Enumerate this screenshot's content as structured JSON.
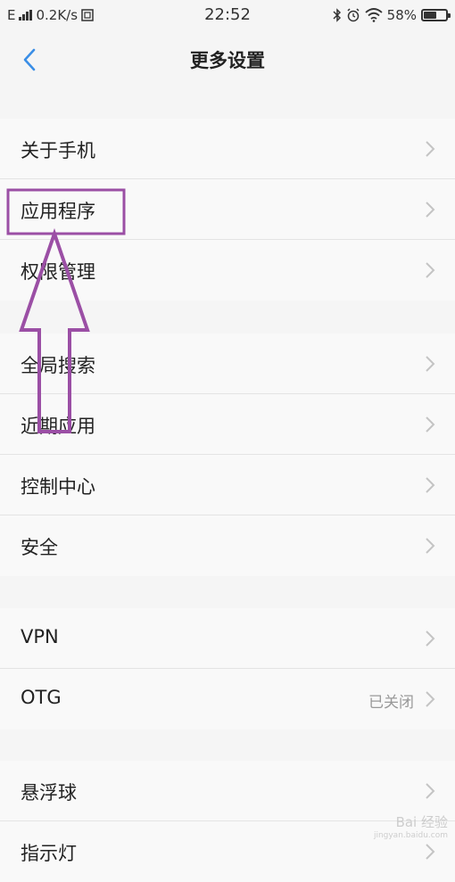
{
  "status_bar": {
    "network_type": "E",
    "speed": "0.2K/s",
    "time": "22:52",
    "battery_percent": "58%",
    "battery_level": 0.58,
    "icons": [
      "signal-icon",
      "sim-icon",
      "bluetooth-icon",
      "alarm-icon",
      "wifi-icon",
      "battery-icon"
    ]
  },
  "header": {
    "title": "更多设置",
    "back_icon": "chevron-left-icon"
  },
  "sections": [
    {
      "items": [
        {
          "label": "关于手机",
          "value": ""
        },
        {
          "label": "应用程序",
          "value": ""
        },
        {
          "label": "权限管理",
          "value": ""
        }
      ]
    },
    {
      "items": [
        {
          "label": "全局搜索",
          "value": ""
        },
        {
          "label": "近期应用",
          "value": ""
        },
        {
          "label": "控制中心",
          "value": ""
        },
        {
          "label": "安全",
          "value": ""
        }
      ]
    },
    {
      "items": [
        {
          "label": "VPN",
          "value": ""
        },
        {
          "label": "OTG",
          "value": "已关闭"
        }
      ]
    },
    {
      "items": [
        {
          "label": "悬浮球",
          "value": ""
        },
        {
          "label": "指示灯",
          "value": ""
        }
      ]
    }
  ],
  "annotation": {
    "color": "#9b4fa5",
    "target": "应用程序"
  },
  "watermark": {
    "text": "Bai 经验",
    "sub": "jingyan.baidu.com"
  },
  "colors": {
    "accent": "#3a8ee6",
    "background": "#f5f5f5",
    "item_bg": "#f9f9f9",
    "secondary_text": "#999999"
  }
}
